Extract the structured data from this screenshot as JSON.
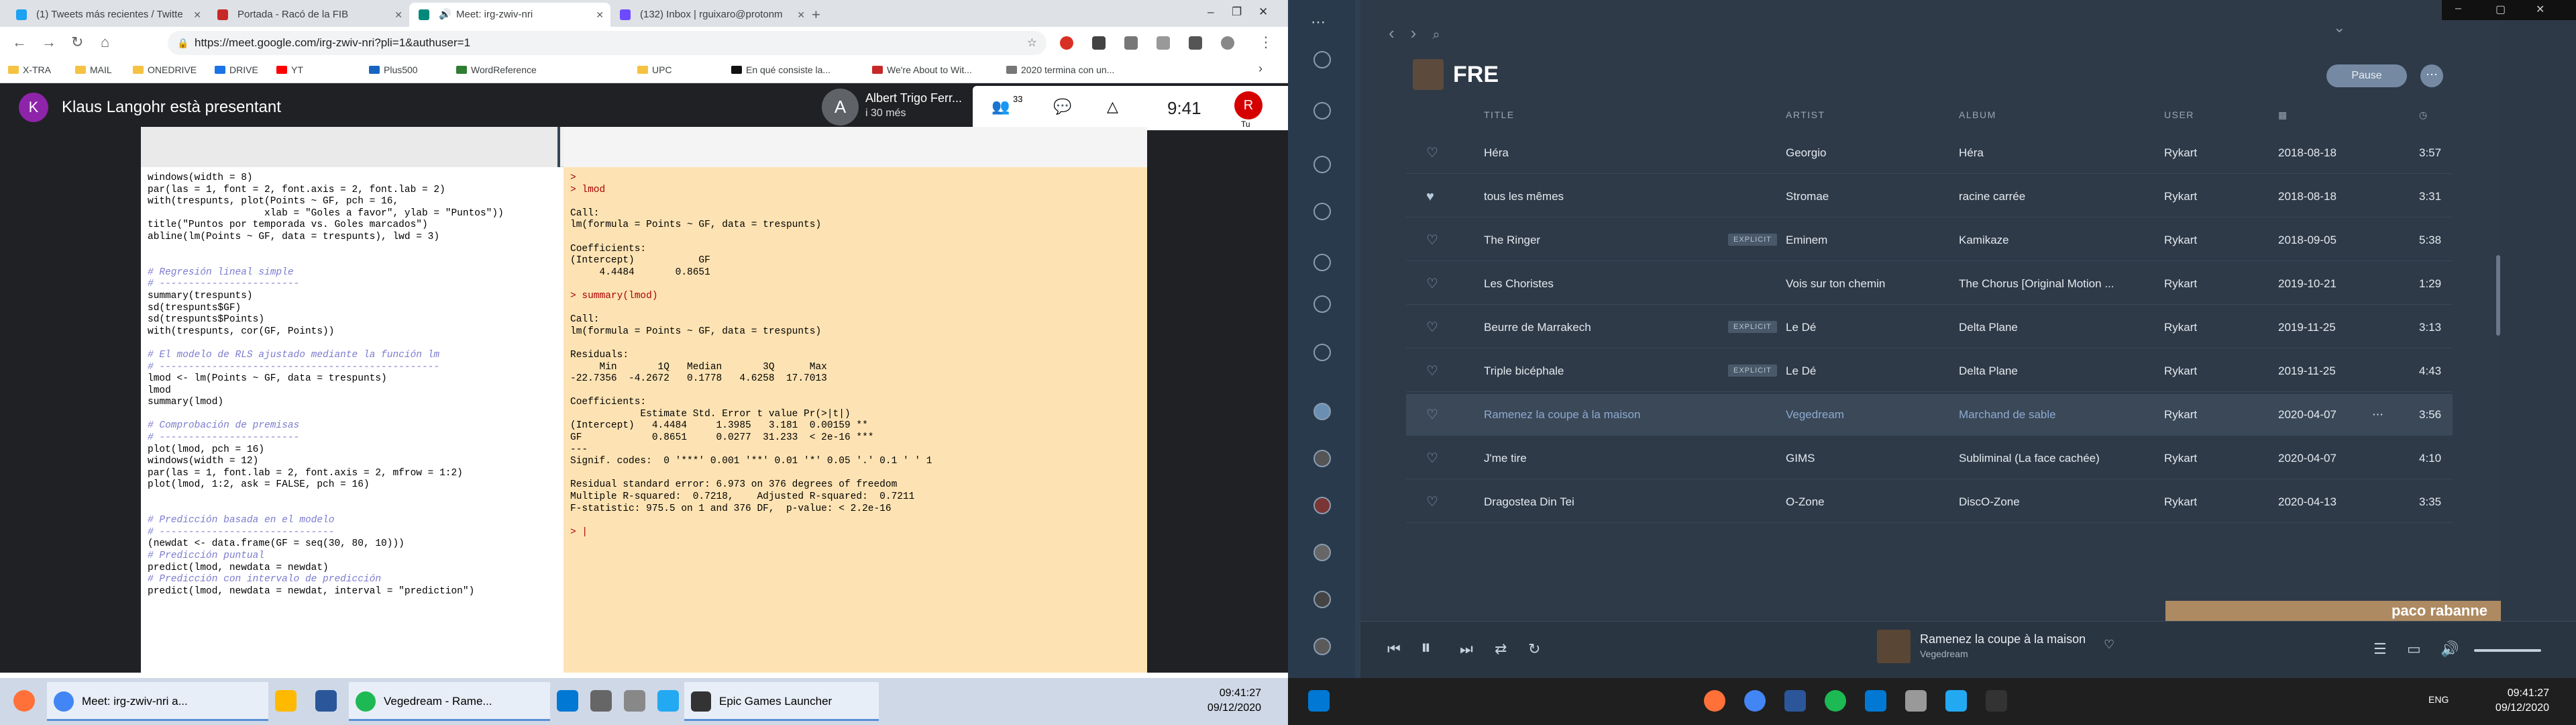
{
  "left": {
    "tabs": [
      {
        "label": "(1) Tweets más recientes / Twitte",
        "color": "#1da1f2"
      },
      {
        "label": "Portada - Racó de la FIB",
        "color": "#c62828"
      },
      {
        "label": "Meet: irg-zwiv-nri",
        "color": "#00897b"
      },
      {
        "label": "(132) Inbox | rguixaro@protonm",
        "color": "#6d4aff"
      }
    ],
    "url": "https://meet.google.com/irg-zwiv-nri?pli=1&authuser=1",
    "bookmarks": [
      "X-TRA",
      "MAIL",
      "ONEDRIVE",
      "DRIVE",
      "YT",
      "Plus500",
      "WordReference",
      "UPC",
      "En qué consiste la...",
      "We're About to Wit...",
      "2020 termina con un..."
    ],
    "meet": {
      "presenter_initial": "K",
      "presenter": "Klaus Langohr està presentant",
      "participant_initial": "A",
      "participant_name": "Albert Trigo Ferr...",
      "participant_sub": "i 30 més",
      "participants_count": "33",
      "time": "9:41",
      "self_initial": "R",
      "self_label": "Tu"
    },
    "r_editor_lines": [
      {
        "t": "windows(width = 8)",
        "c": "code"
      },
      {
        "t": "par(las = 1, font = 2, font.axis = 2, font.lab = 2)",
        "c": "code"
      },
      {
        "t": "with(trespunts, plot(Points ~ GF, pch = 16,",
        "c": "code"
      },
      {
        "t": "                    xlab = \"Goles a favor\", ylab = \"Puntos\"))",
        "c": "code"
      },
      {
        "t": "title(\"Puntos por temporada vs. Goles marcados\")",
        "c": "code"
      },
      {
        "t": "abline(lm(Points ~ GF, data = trespunts), lwd = 3)",
        "c": "code"
      },
      {
        "t": "",
        "c": "code"
      },
      {
        "t": "",
        "c": "code"
      },
      {
        "t": "# Regresión lineal simple",
        "c": "cm"
      },
      {
        "t": "# ------------------------",
        "c": "cm"
      },
      {
        "t": "summary(trespunts)",
        "c": "code"
      },
      {
        "t": "sd(trespunts$GF)",
        "c": "code"
      },
      {
        "t": "sd(trespunts$Points)",
        "c": "code"
      },
      {
        "t": "with(trespunts, cor(GF, Points))",
        "c": "code"
      },
      {
        "t": "",
        "c": "code"
      },
      {
        "t": "# El modelo de RLS ajustado mediante la función lm",
        "c": "cm"
      },
      {
        "t": "# ------------------------------------------------",
        "c": "cm"
      },
      {
        "t": "lmod <- lm(Points ~ GF, data = trespunts)",
        "c": "code"
      },
      {
        "t": "lmod",
        "c": "code"
      },
      {
        "t": "summary(lmod)",
        "c": "code"
      },
      {
        "t": "",
        "c": "code"
      },
      {
        "t": "# Comprobación de premisas",
        "c": "cm"
      },
      {
        "t": "# ------------------------",
        "c": "cm"
      },
      {
        "t": "plot(lmod, pch = 16)",
        "c": "code"
      },
      {
        "t": "windows(width = 12)",
        "c": "code"
      },
      {
        "t": "par(las = 1, font.lab = 2, font.axis = 2, mfrow = 1:2)",
        "c": "code"
      },
      {
        "t": "plot(lmod, 1:2, ask = FALSE, pch = 16)",
        "c": "code"
      },
      {
        "t": "",
        "c": "code"
      },
      {
        "t": "",
        "c": "code"
      },
      {
        "t": "# Predicción basada en el modelo",
        "c": "cm"
      },
      {
        "t": "# ------------------------------",
        "c": "cm"
      },
      {
        "t": "(newdat <- data.frame(GF = seq(30, 80, 10)))",
        "c": "code"
      },
      {
        "t": "# Predicción puntual",
        "c": "cm"
      },
      {
        "t": "predict(lmod, newdata = newdat)",
        "c": "code"
      },
      {
        "t": "# Predicción con intervalo de predicción",
        "c": "cm"
      },
      {
        "t": "predict(lmod, newdata = newdat, interval = \"prediction\")",
        "c": "code"
      }
    ],
    "r_console_lines": [
      ">",
      "> lmod",
      "",
      "Call:",
      "lm(formula = Points ~ GF, data = trespunts)",
      "",
      "Coefficients:",
      "(Intercept)           GF",
      "     4.4484       0.8651",
      "",
      "> summary(lmod)",
      "",
      "Call:",
      "lm(formula = Points ~ GF, data = trespunts)",
      "",
      "Residuals:",
      "     Min       1Q   Median       3Q      Max",
      "-22.7356  -4.2672   0.1778   4.6258  17.7013",
      "",
      "Coefficients:",
      "            Estimate Std. Error t value Pr(>|t|)",
      "(Intercept)   4.4484     1.3985   3.181  0.00159 **",
      "GF            0.8651     0.0277  31.233  < 2e-16 ***",
      "---",
      "Signif. codes:  0 '***' 0.001 '**' 0.01 '*' 0.05 '.' 0.1 ' ' 1",
      "",
      "Residual standard error: 6.973 on 376 degrees of freedom",
      "Multiple R-squared:  0.7218,    Adjusted R-squared:  0.7211",
      "F-statistic: 975.5 on 1 and 376 DF,  p-value: < 2.2e-16",
      "",
      "> |"
    ],
    "taskbar_apps": [
      {
        "label": "Meet: irg-zwiv-nri a...",
        "color": "#4285f4"
      },
      {
        "label": "Vegedream - Rame...",
        "color": "#1db954"
      },
      {
        "label": "Epic Games Launcher",
        "color": "#333333"
      }
    ],
    "clock_time": "09:41:27",
    "clock_date": "09/12/2020"
  },
  "spotify": {
    "playlist": "FRE",
    "pause_label": "Pause",
    "columns": {
      "title": "TITLE",
      "artist": "ARTIST",
      "album": "ALBUM",
      "user": "USER"
    },
    "tracks": [
      {
        "title": "Héra",
        "explicit": "",
        "artist": "Georgio",
        "album": "Héra",
        "user": "Rykart",
        "date": "2018-08-18",
        "dur": "3:57"
      },
      {
        "title": "tous les mêmes",
        "explicit": "",
        "artist": "Stromae",
        "album": "racine carrée",
        "user": "Rykart",
        "date": "2018-08-18",
        "dur": "3:31"
      },
      {
        "title": "The Ringer",
        "explicit": "EXPLICIT",
        "artist": "Eminem",
        "album": "Kamikaze",
        "user": "Rykart",
        "date": "2018-09-05",
        "dur": "5:38"
      },
      {
        "title": "Les Choristes",
        "explicit": "",
        "artist": "Vois sur ton chemin",
        "album": "The Chorus [Original Motion ...",
        "user": "Rykart",
        "date": "2019-10-21",
        "dur": "1:29"
      },
      {
        "title": "Beurre de Marrakech",
        "explicit": "EXPLICIT",
        "artist": "Le Dé",
        "album": "Delta Plane",
        "user": "Rykart",
        "date": "2019-11-25",
        "dur": "3:13"
      },
      {
        "title": "Triple bicéphale",
        "explicit": "EXPLICIT",
        "artist": "Le Dé",
        "album": "Delta Plane",
        "user": "Rykart",
        "date": "2019-11-25",
        "dur": "4:43"
      },
      {
        "title": "Ramenez la coupe à la maison",
        "explicit": "",
        "artist": "Vegedream",
        "album": "Marchand de sable",
        "user": "Rykart",
        "date": "2020-04-07",
        "dur": "3:56"
      },
      {
        "title": "J'me tire",
        "explicit": "",
        "artist": "GIMS",
        "album": "Subliminal (La face cachée)",
        "user": "Rykart",
        "date": "2020-04-07",
        "dur": "4:10"
      },
      {
        "title": "Dragostea Din Tei",
        "explicit": "",
        "artist": "O-Zone",
        "album": "DiscO-Zone",
        "user": "Rykart",
        "date": "2020-04-13",
        "dur": "3:35"
      }
    ],
    "ad_text": "paco rabanne",
    "now_playing_title": "Ramenez la coupe à la maison",
    "now_playing_artist": "Vegedream",
    "clock_time": "09:41:27",
    "clock_date": "09/12/2020",
    "lang": "ENG"
  }
}
